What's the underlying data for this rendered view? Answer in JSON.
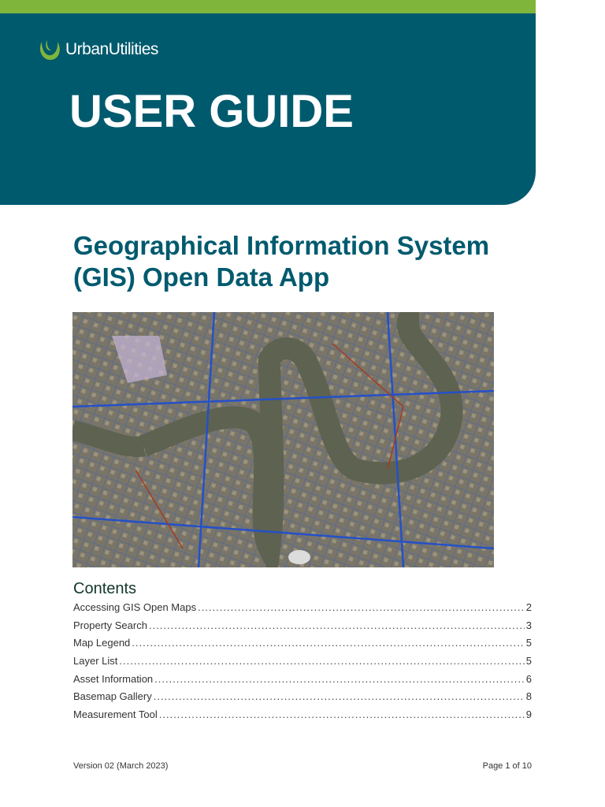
{
  "brand": {
    "name_bold": "Urban",
    "name_light": "Utilities"
  },
  "header": {
    "title": "USER GUIDE"
  },
  "document": {
    "title_line1": "Geographical Information System",
    "title_line2": "(GIS) Open Data App"
  },
  "colors": {
    "teal": "#005a6e",
    "green": "#80b53b"
  },
  "contents": {
    "heading": "Contents",
    "items": [
      {
        "label": "Accessing GIS Open Maps",
        "page": "2"
      },
      {
        "label": "Property Search",
        "page": "3"
      },
      {
        "label": "Map Legend",
        "page": "5"
      },
      {
        "label": "Layer List",
        "page": "5"
      },
      {
        "label": "Asset Information",
        "page": "6"
      },
      {
        "label": "Basemap Gallery",
        "page": "8"
      },
      {
        "label": "Measurement Tool",
        "page": "9"
      }
    ]
  },
  "footer": {
    "version": "Version 02 (March 2023)",
    "page": "Page 1 of 10"
  }
}
